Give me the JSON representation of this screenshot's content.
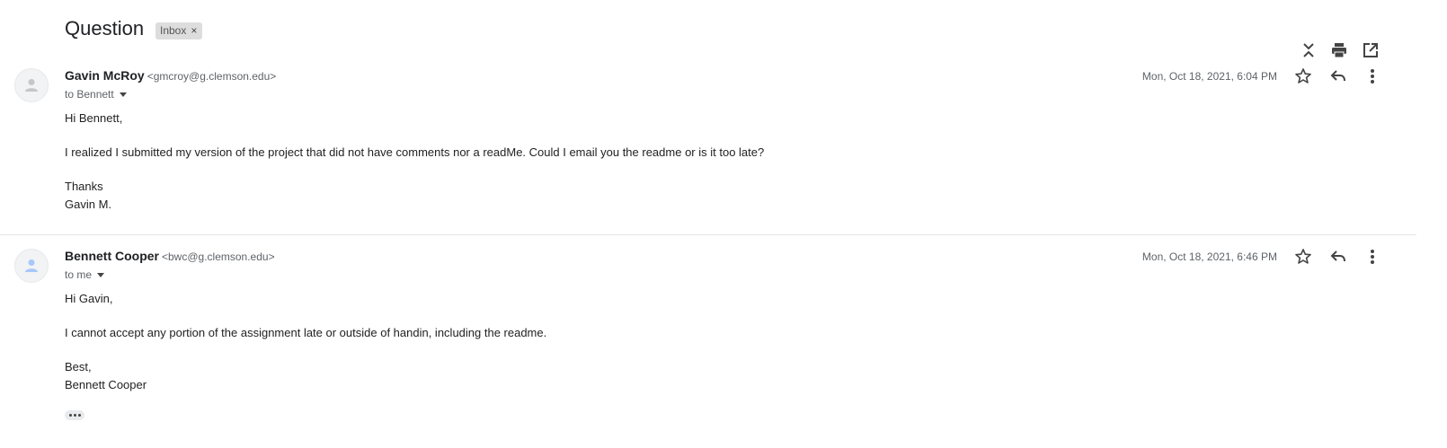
{
  "thread": {
    "subject": "Question",
    "label": "Inbox",
    "label_remove": "×"
  },
  "header_icons": [
    "expand-collapse-icon",
    "print-icon",
    "open-in-new-window-icon"
  ],
  "messages": [
    {
      "sender_name": "Gavin McRoy",
      "sender_email": "<gmcroy@g.clemson.edu>",
      "to": "to Bennett",
      "date": "Mon, Oct 18, 2021, 6:04 PM",
      "body": {
        "greeting": "Hi Bennett,",
        "paragraph": "I realized I submitted my version of the project that did not have comments nor a readMe.  Could I email you the readme or is it too late?",
        "closing": "Thanks",
        "signature": "Gavin M."
      }
    },
    {
      "sender_name": "Bennett Cooper",
      "sender_email": "<bwc@g.clemson.edu>",
      "to": "to me",
      "date": "Mon, Oct 18, 2021, 6:46 PM",
      "body": {
        "greeting": "Hi Gavin,",
        "paragraph": "I cannot accept any portion of the assignment late or outside of handin, including the readme.",
        "closing": "Best,",
        "signature": "Bennett Cooper"
      }
    }
  ],
  "colors": {
    "avatar_bg": "#f1f3f4",
    "avatar_icon_1": "#c4c7c5",
    "avatar_icon_2": "#a8c7fa",
    "text_primary": "#202124",
    "text_secondary": "#5f6368"
  }
}
